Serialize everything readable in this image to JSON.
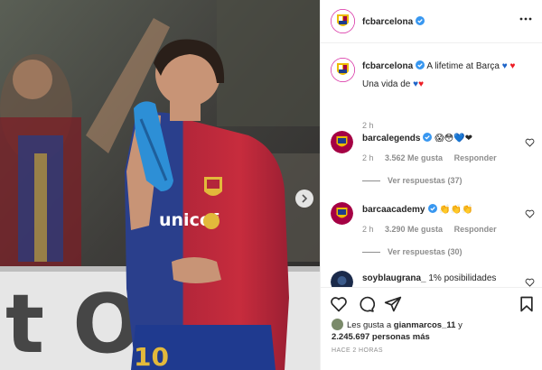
{
  "account": {
    "username": "fcbarcelona",
    "verified": true,
    "more_icon": "more-options-icon"
  },
  "caption": {
    "username": "fcbarcelona",
    "text": "A lifetime at Barça",
    "line2": "Una vida de",
    "time": "2 h"
  },
  "comments": [
    {
      "username": "barcalegends",
      "verified": true,
      "emoji": "😱😳💙❤",
      "time": "2 h",
      "likes": "3.562 Me gusta",
      "reply": "Responder",
      "view_replies": "Ver respuestas (37)"
    },
    {
      "username": "barcaacademy",
      "verified": true,
      "emoji": "👏👏👏",
      "time": "2 h",
      "likes": "3.290 Me gusta",
      "reply": "Responder",
      "view_replies": "Ver respuestas (30)"
    },
    {
      "username": "soyblaugrana_",
      "verified": false,
      "text": "1% posibilidades"
    }
  ],
  "liked_by": {
    "prefix": "Les gusta a",
    "user": "gianmarcos_11",
    "conj": "y",
    "count": "2.245.697",
    "suffix": "personas más"
  },
  "posted_ago": "HACE 2 HORAS",
  "colors": {
    "verified": "#3897f0",
    "barca_blue": "#1e3c8c",
    "barca_red": "#a50044",
    "gold": "#edbb00"
  },
  "icons": [
    "like-icon",
    "comment-icon",
    "share-icon",
    "save-icon",
    "next-arrow-icon"
  ]
}
